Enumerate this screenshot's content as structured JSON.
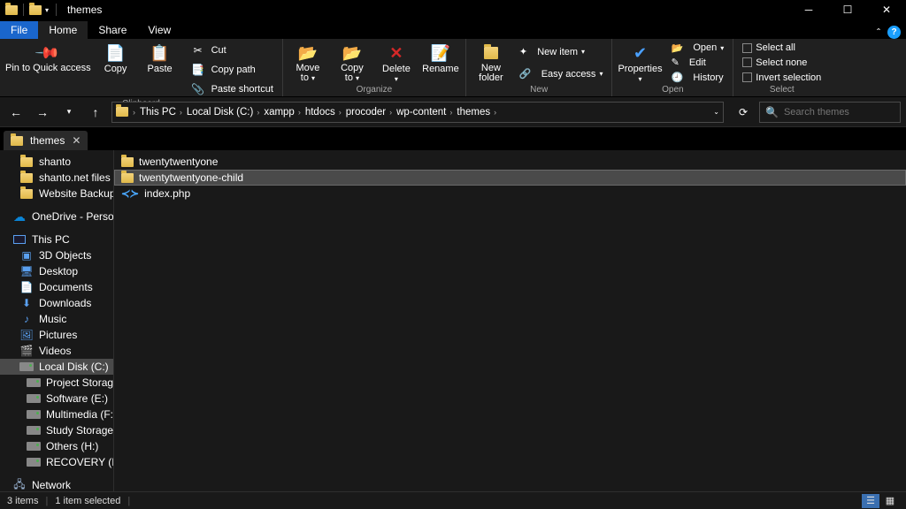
{
  "title": "themes",
  "ribbon_tabs": {
    "file": "File",
    "home": "Home",
    "share": "Share",
    "view": "View"
  },
  "ribbon": {
    "pin": "Pin to Quick access",
    "copy": "Copy",
    "paste": "Paste",
    "cut": "Cut",
    "copy_path": "Copy path",
    "paste_shortcut": "Paste shortcut",
    "clipboard": "Clipboard",
    "move_to": "Move to",
    "copy_to": "Copy to",
    "delete": "Delete",
    "rename": "Rename",
    "organize": "Organize",
    "new_folder": "New folder",
    "new_item": "New item",
    "easy_access": "Easy access",
    "new": "New",
    "properties": "Properties",
    "open": "Open",
    "edit": "Edit",
    "history": "History",
    "open_group": "Open",
    "select_all": "Select all",
    "select_none": "Select none",
    "invert_selection": "Invert selection",
    "select": "Select"
  },
  "breadcrumbs": [
    "This PC",
    "Local Disk (C:)",
    "xampp",
    "htdocs",
    "procoder",
    "wp-content",
    "themes"
  ],
  "search": {
    "placeholder": "Search themes"
  },
  "doc_tab": {
    "label": "themes"
  },
  "tree": {
    "items": [
      {
        "label": "shanto",
        "icon": "folder",
        "indent": "sub"
      },
      {
        "label": "shanto.net files",
        "icon": "folder",
        "indent": "sub"
      },
      {
        "label": "Website Backup",
        "icon": "folder",
        "indent": "sub"
      }
    ],
    "onedrive": "OneDrive - Persor",
    "thispc": "This PC",
    "pc_items": [
      {
        "label": "3D Objects",
        "icon": "objects"
      },
      {
        "label": "Desktop",
        "icon": "desktop"
      },
      {
        "label": "Documents",
        "icon": "docs"
      },
      {
        "label": "Downloads",
        "icon": "downloads"
      },
      {
        "label": "Music",
        "icon": "music"
      },
      {
        "label": "Pictures",
        "icon": "pictures"
      },
      {
        "label": "Videos",
        "icon": "videos"
      }
    ],
    "drives": [
      {
        "label": "Local Disk (C:)",
        "sel": true
      },
      {
        "label": "Project Storage (",
        "sel": false
      },
      {
        "label": "Software (E:)",
        "sel": false
      },
      {
        "label": "Multimedia (F:)",
        "sel": false
      },
      {
        "label": "Study Storage pr",
        "sel": false
      },
      {
        "label": "Others (H:)",
        "sel": false
      },
      {
        "label": "RECOVERY (I:)",
        "sel": false
      }
    ],
    "network": "Network"
  },
  "files": [
    {
      "name": "twentytwentyone",
      "type": "folder",
      "sel": false
    },
    {
      "name": "twentytwentyone-child",
      "type": "folder",
      "sel": true
    },
    {
      "name": "index.php",
      "type": "php",
      "sel": false
    }
  ],
  "status": {
    "items": "3 items",
    "selected": "1 item selected"
  }
}
